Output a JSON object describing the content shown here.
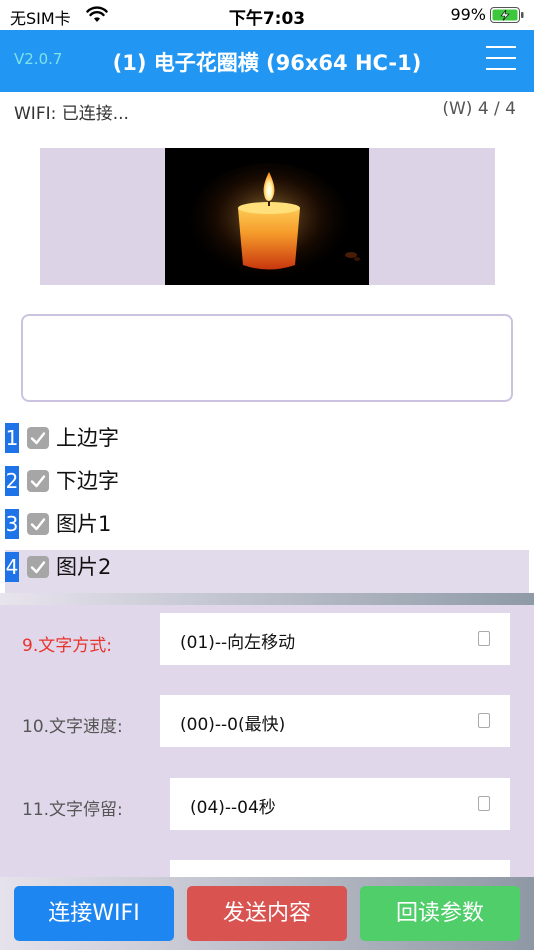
{
  "status_bar": {
    "carrier": "无SIM卡",
    "time": "下午7:03",
    "battery_percent": "99%",
    "icons": [
      "wifi-icon",
      "battery-charging-icon"
    ]
  },
  "nav": {
    "version": "V2.0.7",
    "title": "(1) 电子花圈横 (96x64 HC-1)",
    "menu_icon": "hamburger-menu-icon"
  },
  "connection": {
    "wifi_status": "WIFI: 已连接...",
    "page_indicator": "(W) 4 / 4"
  },
  "preview": {
    "image": "candle-image"
  },
  "text_input": {
    "value": "",
    "placeholder": ""
  },
  "layers": [
    {
      "number": "1",
      "label": "上边字",
      "checked": true
    },
    {
      "number": "2",
      "label": "下边字",
      "checked": true
    },
    {
      "number": "3",
      "label": "图片1",
      "checked": true
    },
    {
      "number": "4",
      "label": "图片2",
      "checked": true,
      "selected": true
    }
  ],
  "settings": [
    {
      "label": "9.文字方式:",
      "value": "(01)--向左移动",
      "active": true
    },
    {
      "label": "10.文字速度:",
      "value": "(00)--0(最快)"
    },
    {
      "label": "11.文字停留:",
      "value": "(04)--04秒"
    }
  ],
  "buttons": {
    "connect_wifi": "连接WIFI",
    "send_content": "发送内容",
    "read_params": "回读参数"
  },
  "colors": {
    "nav_background": "#2196f3",
    "active_setting_label": "#e8322a",
    "connect_button": "#1e86f0",
    "send_button": "#d95350",
    "readback_button": "#4fce6a",
    "layer_number": "#1e73e8",
    "selected_row": "#e2dbec"
  }
}
